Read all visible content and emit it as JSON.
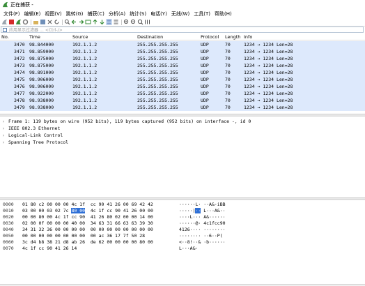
{
  "window": {
    "title": "正在捕获 -"
  },
  "menu": [
    "文件(F)",
    "编辑(E)",
    "视图(V)",
    "跳转(G)",
    "捕获(C)",
    "分析(A)",
    "统计(S)",
    "电话(Y)",
    "无线(W)",
    "工具(T)",
    "帮助(H)"
  ],
  "toolbar_icons": [
    "shark-fin-icon",
    "stop-icon",
    "restart-icon",
    "options-icon",
    "open-icon",
    "save-icon",
    "close-file-icon",
    "reload-icon",
    "find-icon",
    "go-back-icon",
    "go-forward-icon",
    "go-to-packet-icon",
    "first-packet-icon",
    "last-packet-icon",
    "autoscroll-icon",
    "colorize-icon",
    "zoom-in-icon",
    "zoom-out-icon",
    "zoom-reset-icon",
    "resize-columns-icon"
  ],
  "filter": {
    "placeholder": "应用显示过滤器 … <Ctrl-/>"
  },
  "columns": {
    "no": "No.",
    "time": "Time",
    "source": "Source",
    "destination": "Destination",
    "protocol": "Protocol",
    "length": "Length",
    "info": "Info"
  },
  "packets": [
    {
      "no": "3470",
      "time": "98.844000",
      "src": "192.1.1.2",
      "dst": "255.255.255.255",
      "proto": "UDP",
      "len": "70",
      "info": "1234 → 1234 Len=28"
    },
    {
      "no": "3471",
      "time": "98.859000",
      "src": "192.1.1.2",
      "dst": "255.255.255.255",
      "proto": "UDP",
      "len": "70",
      "info": "1234 → 1234 Len=28"
    },
    {
      "no": "3472",
      "time": "98.875000",
      "src": "192.1.1.2",
      "dst": "255.255.255.255",
      "proto": "UDP",
      "len": "70",
      "info": "1234 → 1234 Len=28"
    },
    {
      "no": "3473",
      "time": "98.875000",
      "src": "192.1.1.2",
      "dst": "255.255.255.255",
      "proto": "UDP",
      "len": "70",
      "info": "1234 → 1234 Len=28"
    },
    {
      "no": "3474",
      "time": "98.891000",
      "src": "192.1.1.2",
      "dst": "255.255.255.255",
      "proto": "UDP",
      "len": "70",
      "info": "1234 → 1234 Len=28"
    },
    {
      "no": "3475",
      "time": "98.906000",
      "src": "192.1.1.2",
      "dst": "255.255.255.255",
      "proto": "UDP",
      "len": "70",
      "info": "1234 → 1234 Len=28"
    },
    {
      "no": "3476",
      "time": "98.906000",
      "src": "192.1.1.2",
      "dst": "255.255.255.255",
      "proto": "UDP",
      "len": "70",
      "info": "1234 → 1234 Len=28"
    },
    {
      "no": "3477",
      "time": "98.922000",
      "src": "192.1.1.2",
      "dst": "255.255.255.255",
      "proto": "UDP",
      "len": "70",
      "info": "1234 → 1234 Len=28"
    },
    {
      "no": "3478",
      "time": "98.938000",
      "src": "192.1.1.2",
      "dst": "255.255.255.255",
      "proto": "UDP",
      "len": "70",
      "info": "1234 → 1234 Len=28"
    },
    {
      "no": "3479",
      "time": "98.938000",
      "src": "192.1.1.2",
      "dst": "255.255.255.255",
      "proto": "UDP",
      "len": "70",
      "info": "1234 → 1234 Len=28"
    }
  ],
  "details": [
    "Frame 1: 119 bytes on wire (952 bits), 119 bytes captured (952 bits) on interface -, id 0",
    "IEEE 802.3 Ethernet",
    "Logical-Link Control",
    "Spanning Tree Protocol"
  ],
  "hex": [
    {
      "offset": "0000",
      "a": "01 80 c2 00 00 00 4c 1f  cc 90 41 26 00 69 42 42",
      "asc": "······L· ··A&·iBB"
    },
    {
      "offset": "0010",
      "a": "03 00 00 03 02 7c ",
      "sel": "80 00",
      "b": "  4c 1f cc 90 41 26 00 00",
      "asc_a": "·····|",
      "asc_sel": "··",
      "asc_b": " L···A&··"
    },
    {
      "offset": "0020",
      "a": "00 00 80 00 4c 1f cc 90  41 26 80 02 00 00 14 00",
      "asc": "····L··· A&······"
    },
    {
      "offset": "0030",
      "a": "02 00 0f 00 00 00 40 00  34 63 31 66 63 63 39 30",
      "asc": "······@· 4c1fcc90"
    },
    {
      "offset": "0040",
      "a": "34 31 32 36 00 00 00 00  00 00 00 00 00 00 00 00",
      "asc": "4126···· ········"
    },
    {
      "offset": "0050",
      "a": "00 00 00 00 00 00 00 00  00 ac 36 17 7f 50 28",
      "asc": "········ ··6··P("
    },
    {
      "offset": "0060",
      "a": "3c d4 b8 38 21 d8 ab 26  de 62 00 00 00 00 80 00",
      "asc": "<··8!··& ·b······"
    },
    {
      "offset": "0070",
      "a": "4c 1f cc 90 41 26 14",
      "asc": "L···A&·"
    }
  ],
  "colors": {
    "row_bg": "#dde9fc",
    "selection": "#2e6fd6"
  }
}
